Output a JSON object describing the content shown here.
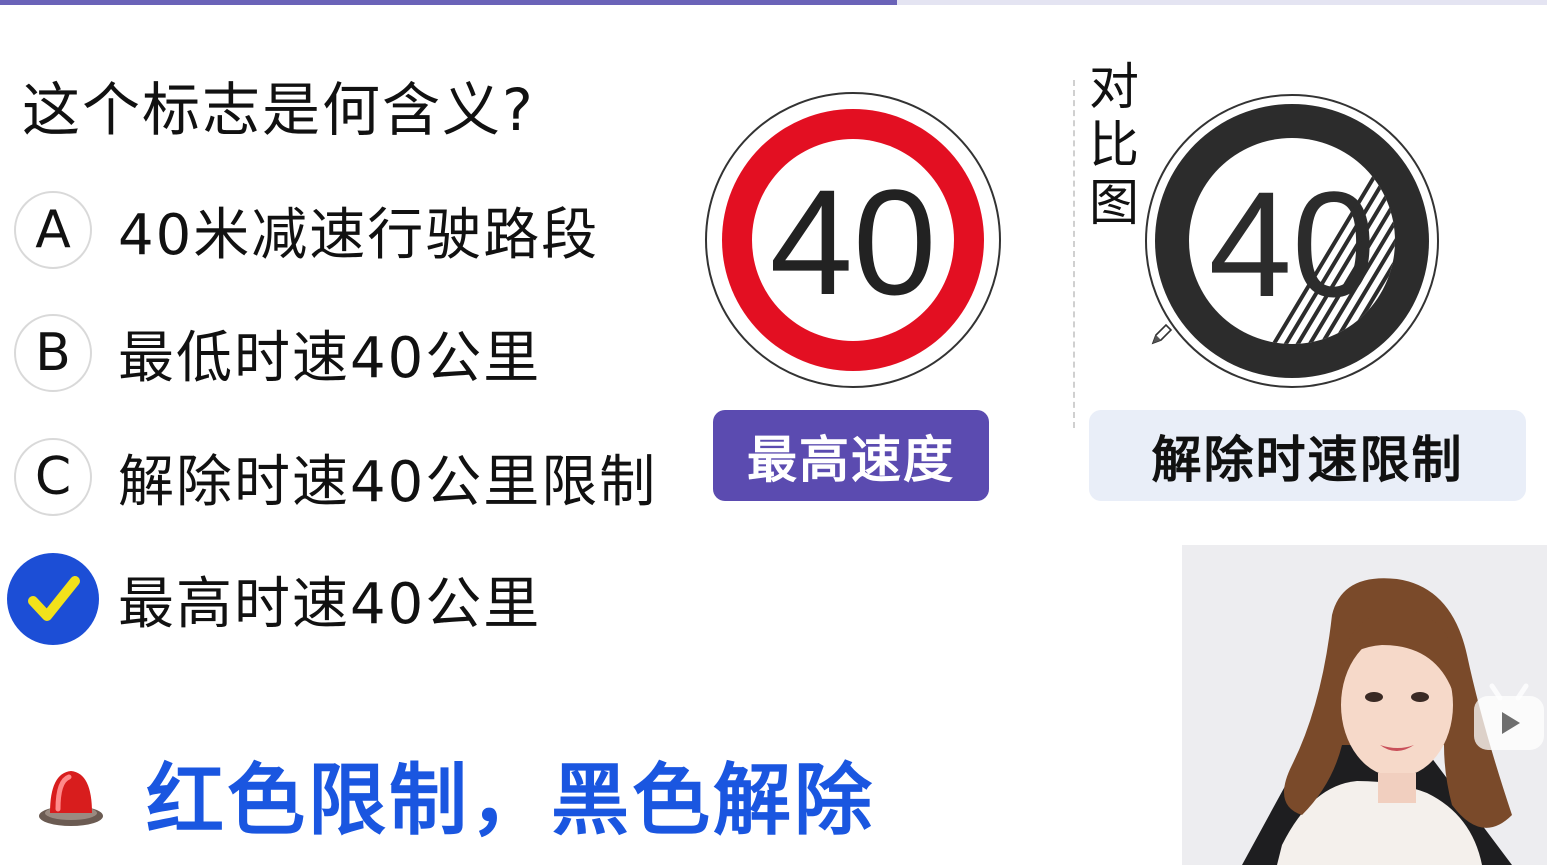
{
  "progress": {
    "fraction": 0.58
  },
  "question": {
    "text": "这个标志是何含义?"
  },
  "options": [
    {
      "letter": "A",
      "text": "40米减速行驶路段"
    },
    {
      "letter": "B",
      "text": "最低时速40公里"
    },
    {
      "letter": "C",
      "text": "解除时速40公里限制"
    },
    {
      "letter": "",
      "text": "最高时速40公里",
      "selected": true
    }
  ],
  "signs": {
    "max_speed": {
      "number": "40",
      "label": "最高速度",
      "ring_color": "#e30f22"
    },
    "release": {
      "number": "40",
      "label": "解除时速限制",
      "ring_color": "#2c2c2c"
    },
    "compare_label": "对比图"
  },
  "tip": {
    "text": "红色限制，黑色解除",
    "icon": "siren-light-icon",
    "color": "#1a56e0"
  },
  "colors": {
    "check_bg": "#1c4ed6",
    "check_mark": "#f2e21a",
    "tag_max_bg": "#5b4bb0",
    "tag_release_bg": "#e9eef8"
  }
}
